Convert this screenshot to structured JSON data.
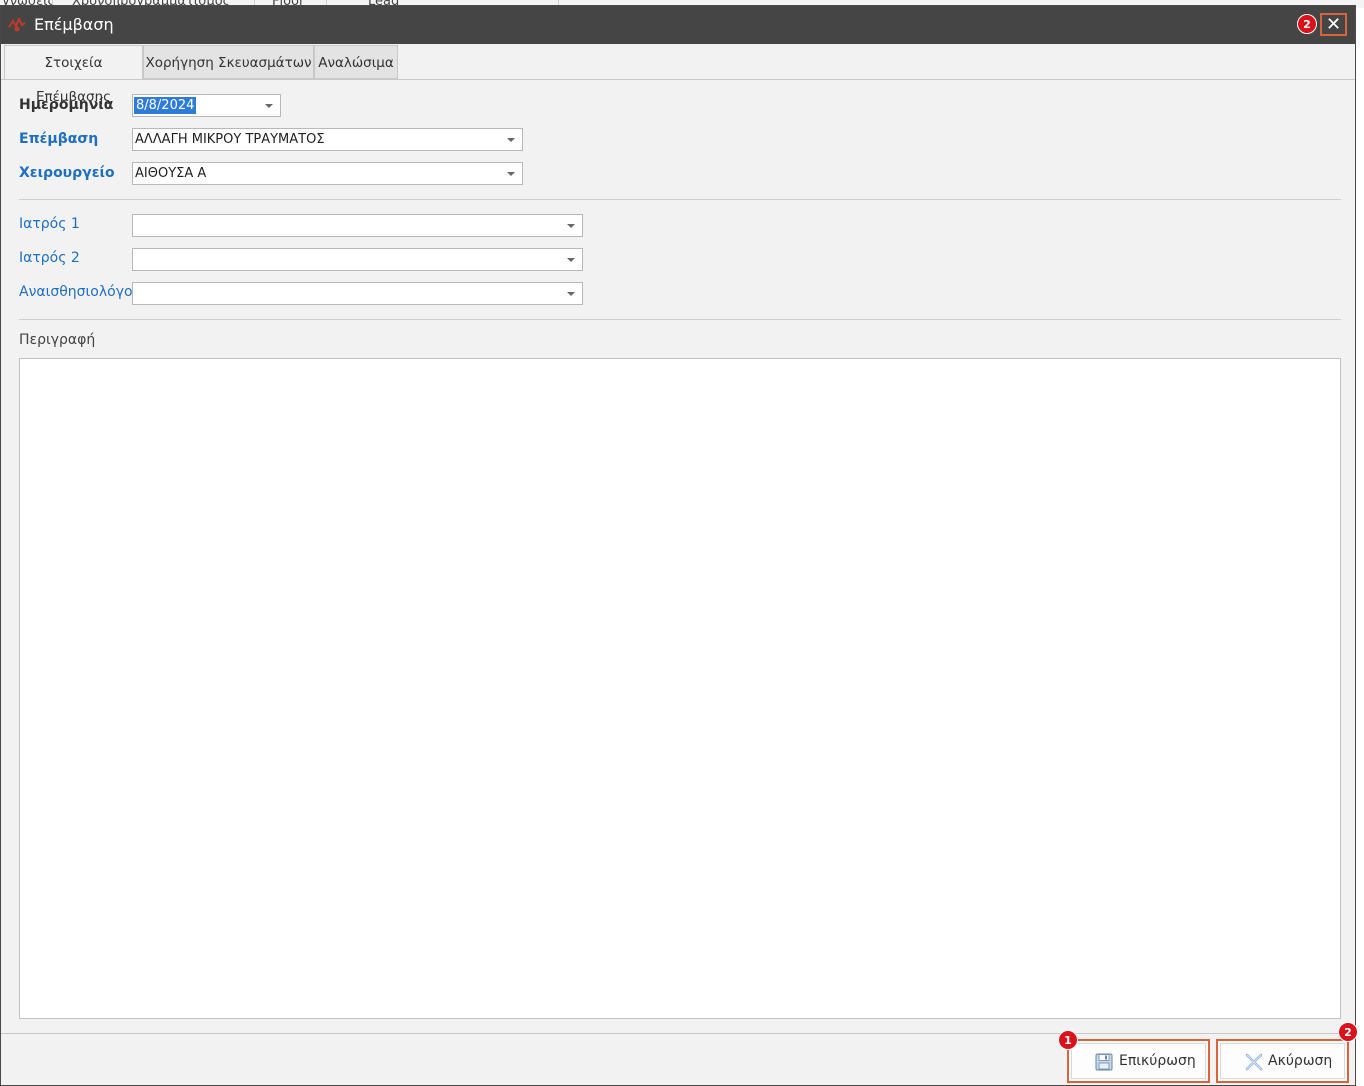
{
  "background": {
    "header_fragments": [
      "γνωσεις",
      "Χρονοπρογραμματισμός",
      "Floor",
      "Lead"
    ]
  },
  "dialog": {
    "title": "Επέμβαση",
    "close_symbol": "✕",
    "close_badge": "2"
  },
  "tabs": [
    {
      "label": "Στοιχεία Επέμβασης",
      "active": true
    },
    {
      "label": "Χορήγηση Σκευασμάτων",
      "active": false
    },
    {
      "label": "Αναλώσιμα",
      "active": false
    }
  ],
  "form": {
    "date": {
      "label": "Ημερομηνία",
      "value": "8/8/2024"
    },
    "procedure": {
      "label": "Επέμβαση",
      "value": "ΑΛΛΑΓΗ ΜΙΚΡΟΥ ΤΡΑΥΜΑΤΟΣ"
    },
    "operating_room": {
      "label": "Χειρουργείο",
      "value": "ΑΙΘΟΥΣΑ Α"
    },
    "doctor1": {
      "label": "Ιατρός 1",
      "value": ""
    },
    "doctor2": {
      "label": "Ιατρός 2",
      "value": ""
    },
    "anesthesiologist": {
      "label": "Αναισθησιολόγος",
      "value": ""
    },
    "description": {
      "label": "Περιγραφή",
      "value": ""
    }
  },
  "buttons": {
    "confirm": {
      "label": "Επικύρωση",
      "badge": "1",
      "icon": "save-icon"
    },
    "cancel": {
      "label": "Ακύρωση",
      "badge": "2",
      "icon": "cancel-x-icon"
    }
  },
  "colors": {
    "titlebar": "#454545",
    "accent_blue": "#1e6fc0",
    "highlight_border": "#d6643c",
    "badge_red": "#d9121b"
  }
}
